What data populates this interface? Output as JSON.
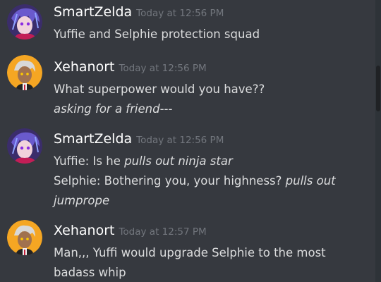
{
  "messages": [
    {
      "author": "SmartZelda",
      "avatar": "smartzelda-avatar",
      "timestamp": "Today at 12:56 PM",
      "lines": [
        [
          {
            "text": "Yuffie and Selphie protection squad",
            "italic": false
          }
        ]
      ]
    },
    {
      "author": "Xehanort",
      "avatar": "xehanort-avatar",
      "timestamp": "Today at 12:56 PM",
      "lines": [
        [
          {
            "text": "What superpower would you have??",
            "italic": false
          }
        ],
        [
          {
            "text": "asking for a friend",
            "italic": true
          },
          {
            "text": "---",
            "italic": false
          }
        ]
      ]
    },
    {
      "author": "SmartZelda",
      "avatar": "smartzelda-avatar",
      "timestamp": "Today at 12:56 PM",
      "lines": [
        [
          {
            "text": "Yuffie: Is he ",
            "italic": false
          },
          {
            "text": "pulls out ninja star",
            "italic": true
          }
        ],
        [
          {
            "text": "Selphie: Bothering you, your highness? ",
            "italic": false
          },
          {
            "text": "pulls out",
            "italic": true
          }
        ],
        [
          {
            "text": "jumprope",
            "italic": true
          }
        ]
      ]
    },
    {
      "author": "Xehanort",
      "avatar": "xehanort-avatar",
      "timestamp": "Today at 12:57 PM",
      "lines": [
        [
          {
            "text": "Man,,, Yuffi would upgrade Selphie to the most",
            "italic": false
          }
        ],
        [
          {
            "text": "badass whip",
            "italic": false
          }
        ]
      ]
    }
  ],
  "colors": {
    "background": "#36393f",
    "author": "#ffffff",
    "timestamp": "#72767d",
    "text": "#dcddde",
    "smartzelda_avatar_bg": "#3b2d6b",
    "xehanort_avatar_bg": "#f5a623"
  }
}
